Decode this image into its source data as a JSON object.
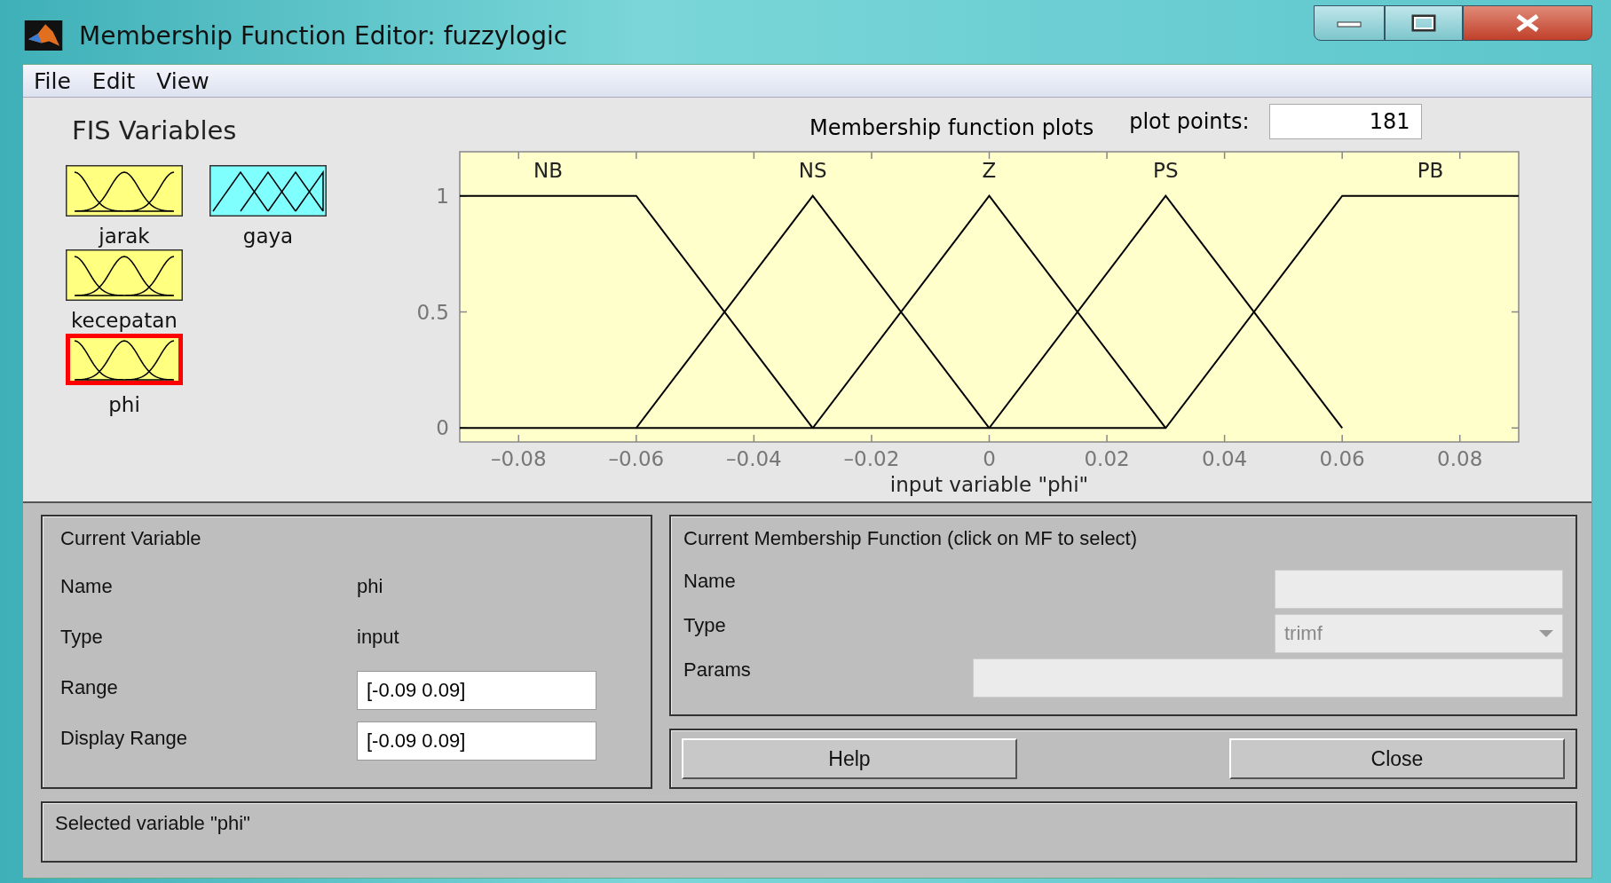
{
  "window": {
    "title": "Membership Function Editor: fuzzylogic"
  },
  "menu": [
    "File",
    "Edit",
    "View"
  ],
  "fis_variables": {
    "title": "FIS Variables",
    "inputs": [
      {
        "name": "jarak",
        "selected": false
      },
      {
        "name": "kecepatan",
        "selected": false
      },
      {
        "name": "phi",
        "selected": true
      }
    ],
    "outputs": [
      {
        "name": "gaya",
        "selected": false
      }
    ]
  },
  "plot": {
    "title": "Membership function plots",
    "plot_points_label": "plot points:",
    "plot_points": "181",
    "chart_data": {
      "type": "line",
      "xlabel": "input variable \"phi\"",
      "x": [
        -0.09,
        -0.06,
        -0.03,
        0,
        0.03,
        0.06,
        0.09
      ],
      "series": [
        {
          "name": "NB",
          "color": "#000000",
          "values": [
            1,
            1,
            0,
            null,
            null,
            null,
            null
          ]
        },
        {
          "name": "NS",
          "color": "#000000",
          "values": [
            0,
            0,
            1,
            0,
            null,
            null,
            null
          ]
        },
        {
          "name": "Z",
          "color": "#000000",
          "values": [
            null,
            0,
            0,
            1,
            0,
            null,
            null
          ]
        },
        {
          "name": "PS",
          "color": "#000000",
          "values": [
            null,
            null,
            0,
            0,
            1,
            0,
            null
          ]
        },
        {
          "name": "PB",
          "color": "#000000",
          "values": [
            null,
            null,
            null,
            0,
            0,
            1,
            1
          ]
        }
      ],
      "xlim": [
        -0.09,
        0.09
      ],
      "ylim": [
        -0.06,
        1.19
      ],
      "xticks": [
        {
          "value": -0.08,
          "label": "–0.08"
        },
        {
          "value": -0.06,
          "label": "–0.06"
        },
        {
          "value": -0.04,
          "label": "–0.04"
        },
        {
          "value": -0.02,
          "label": "–0.02"
        },
        {
          "value": 0,
          "label": "0"
        },
        {
          "value": 0.02,
          "label": "0.02"
        },
        {
          "value": 0.04,
          "label": "0.04"
        },
        {
          "value": 0.06,
          "label": "0.06"
        },
        {
          "value": 0.08,
          "label": "0.08"
        }
      ],
      "yticks": [
        0,
        0.5,
        1
      ]
    }
  },
  "current_variable": {
    "title": "Current Variable",
    "rows": [
      {
        "kind": "text",
        "label": "Name",
        "value": "phi"
      },
      {
        "kind": "text",
        "label": "Type",
        "value": "input"
      },
      {
        "kind": "field",
        "label": "Range",
        "value": "[-0.09 0.09]"
      },
      {
        "kind": "field",
        "label": "Display Range",
        "value": "[-0.09 0.09]"
      }
    ]
  },
  "current_mf": {
    "title": "Current Membership Function (click on MF to select)",
    "rows": [
      {
        "kind": "field",
        "label": "Name",
        "disabled": true
      },
      {
        "kind": "dropdown",
        "label": "Type",
        "value": "trimf",
        "disabled": true
      },
      {
        "kind": "wide_field",
        "label": "Params",
        "disabled": true
      }
    ]
  },
  "buttons": [
    "Help",
    "Close"
  ],
  "status": "Selected variable \"phi\""
}
